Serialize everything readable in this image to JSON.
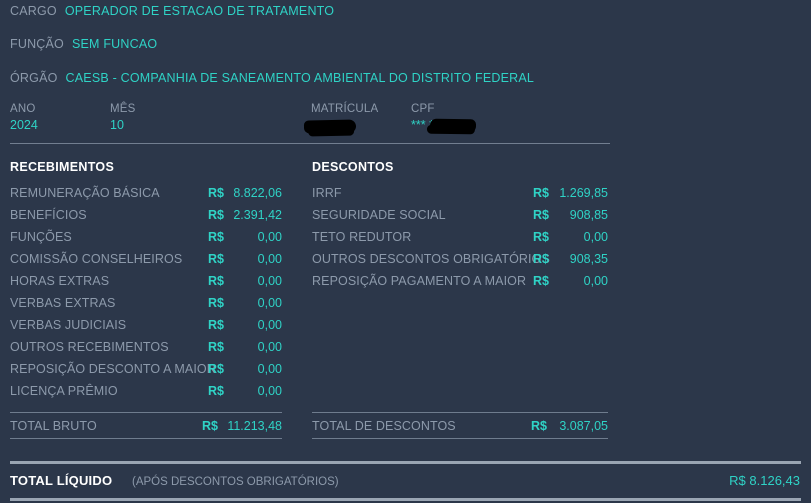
{
  "identity": [
    {
      "label": "CARGO",
      "value": "OPERADOR DE ESTACAO DE TRATAMENTO"
    },
    {
      "label": "FUNÇÃO",
      "value": "SEM FUNCAO"
    },
    {
      "label": "ÓRGÃO",
      "value": "CAESB - COMPANHIA DE SANEAMENTO AMBIENTAL DO DISTRITO FEDERAL"
    }
  ],
  "fields": {
    "ano": {
      "label": "ANO",
      "value": "2024"
    },
    "mes": {
      "label": "MÊS",
      "value": "10"
    },
    "matricula": {
      "label": "MATRÍCULA",
      "value": "",
      "redacted": "true"
    },
    "cpf": {
      "label": "CPF",
      "value": "***        **",
      "redacted": "true"
    }
  },
  "recebimentos": {
    "title": "RECEBIMENTOS",
    "currency": "R$",
    "rows": [
      {
        "name": "REMUNERAÇÃO BÁSICA",
        "currency": "R$",
        "amount": "8.822,06"
      },
      {
        "name": "BENEFÍCIOS",
        "currency": "R$",
        "amount": "2.391,42"
      },
      {
        "name": "FUNÇÕES",
        "currency": "R$",
        "amount": "0,00"
      },
      {
        "name": "COMISSÃO CONSELHEIROS",
        "currency": "R$",
        "amount": "0,00"
      },
      {
        "name": "HORAS EXTRAS",
        "currency": "R$",
        "amount": "0,00"
      },
      {
        "name": "VERBAS EXTRAS",
        "currency": "R$",
        "amount": "0,00"
      },
      {
        "name": "VERBAS JUDICIAIS",
        "currency": "R$",
        "amount": "0,00"
      },
      {
        "name": "OUTROS RECEBIMENTOS",
        "currency": "R$",
        "amount": "0,00"
      },
      {
        "name": "REPOSIÇÃO DESCONTO A MAIOR",
        "currency": "R$",
        "amount": "0,00"
      },
      {
        "name": "LICENÇA PRÊMIO",
        "currency": "R$",
        "amount": "0,00"
      }
    ],
    "total": {
      "name": "TOTAL BRUTO",
      "currency": "R$",
      "amount": "11.213,48"
    }
  },
  "descontos": {
    "title": "DESCONTOS",
    "currency": "R$",
    "rows": [
      {
        "name": "IRRF",
        "currency": "R$",
        "amount": "1.269,85"
      },
      {
        "name": "SEGURIDADE SOCIAL",
        "currency": "R$",
        "amount": "908,85"
      },
      {
        "name": "TETO REDUTOR",
        "currency": "R$",
        "amount": "0,00"
      },
      {
        "name": "OUTROS DESCONTOS OBRIGATÓRIOS",
        "currency": "R$",
        "amount": "908,35"
      },
      {
        "name": "REPOSIÇÃO PAGAMENTO A MAIOR",
        "currency": "R$",
        "amount": "0,00"
      }
    ],
    "total": {
      "name": "TOTAL DE DESCONTOS",
      "currency": "R$",
      "amount": "3.087,05"
    }
  },
  "liquido": {
    "name": "TOTAL LÍQUIDO",
    "note": "(APÓS DESCONTOS OBRIGATÓRIOS)",
    "amount": "R$ 8.126,43"
  },
  "colors": {
    "background": "#2c374a",
    "accent": "#2fd3c6",
    "label": "#8d9aab",
    "heading": "#ffffff",
    "rule": "#7f8b9c",
    "redaction": "#000000"
  }
}
